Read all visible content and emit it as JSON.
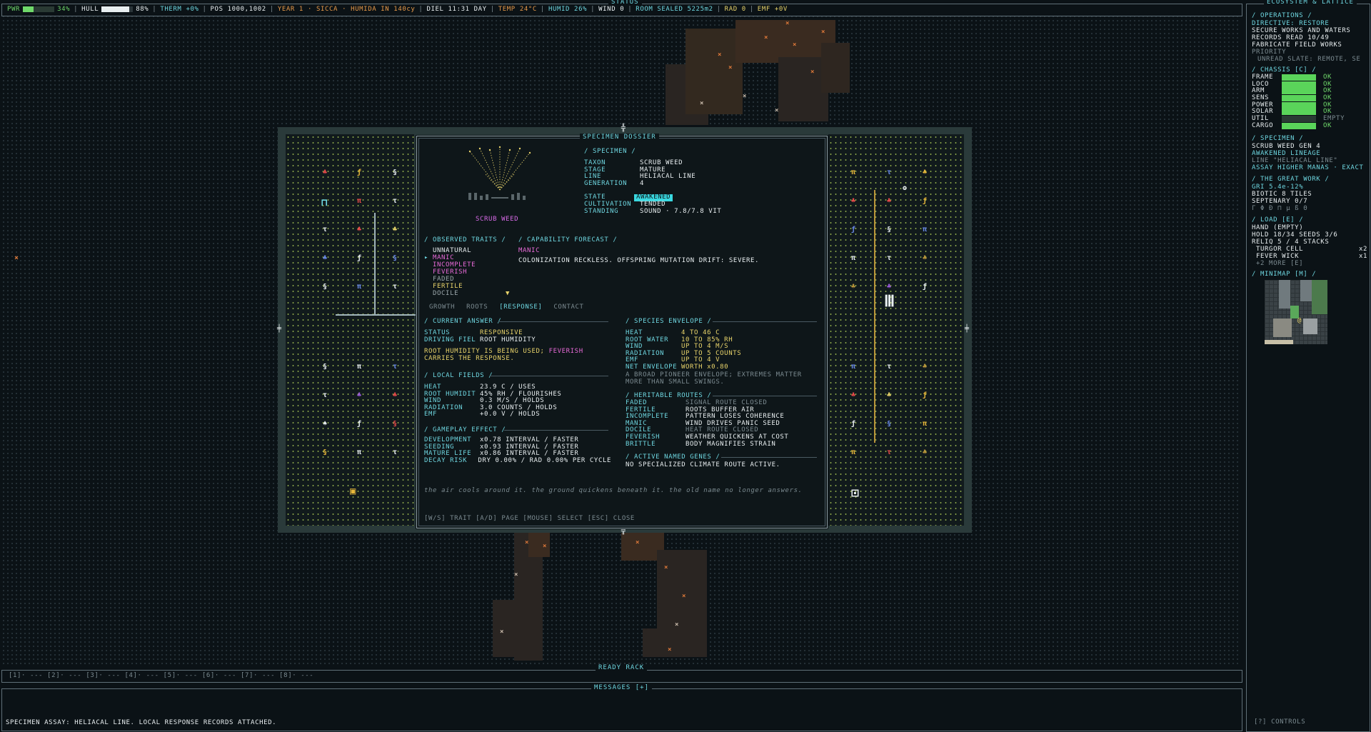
{
  "status_bar": {
    "title": "STATUS",
    "pwr_label": "PWR",
    "pwr_value": "34%",
    "hull_label": "HULL",
    "hull_value": "88%",
    "therm": "THERM +0%",
    "pos": "POS 1000,1002",
    "year": "YEAR 1 · SICCA · HUMIDA IN 140cy",
    "diel": "DIEL 11:31 DAY",
    "temp": "TEMP 24°C",
    "humid": "HUMID 26%",
    "wind": "WIND 0",
    "room": "ROOM SEALED 5225m2",
    "rad": "RAD 0",
    "emf": "EMF +0V",
    "pwr_fraction": 0.34,
    "hull_fraction": 0.88
  },
  "right_panel": {
    "title": "ECOSYSTEM & LATTICE",
    "operations": {
      "header": "/ OPERATIONS /",
      "lines": [
        "DIRECTIVE: RESTORE",
        "SECURE WORKS AND WATERS",
        "RECORDS READ 10/49",
        "FABRICATE FIELD WORKS"
      ],
      "priority_label": "PRIORITY",
      "priority_line": "UNREAD SLATE: REMOTE, SE"
    },
    "chassis": {
      "header": "/ CHASSIS [C] /",
      "rows": [
        {
          "name": "FRAME",
          "status": "OK"
        },
        {
          "name": "LOCO",
          "status": "OK"
        },
        {
          "name": "ARM",
          "status": "OK"
        },
        {
          "name": "SENS",
          "status": "OK"
        },
        {
          "name": "POWER",
          "status": "OK"
        },
        {
          "name": "SOLAR",
          "status": "OK"
        },
        {
          "name": "UTIL",
          "status": "EMPTY"
        },
        {
          "name": "CARGO",
          "status": "OK"
        }
      ]
    },
    "specimen": {
      "header": "/ SPECIMEN /",
      "line1": "SCRUB WEED  GEN 4",
      "line2": "AWAKENED LINEAGE",
      "line3": "LINE \"HELIACAL LINE\"",
      "line4": "ASSAY HIGHER MANAS · EXACT"
    },
    "great_work": {
      "header": "/ THE GREAT WORK /",
      "line1": "GRI 5.4e-12%",
      "line2": "BIOTIC 8 TILES",
      "line3": "SEPTENARY 0/7",
      "line4": "Γ Φ Ð ⊓ μ ß Θ"
    },
    "load": {
      "header": "/ LOAD [E] /",
      "line1": "HAND (EMPTY)",
      "line2": "HOLD 18/34  SEEDS 3/6",
      "line3": "RELIQ 5 / 4 STACKS",
      "items": [
        {
          "name": "TURGOR CELL",
          "count": "x2"
        },
        {
          "name": "FEVER WICK",
          "count": "x1"
        }
      ],
      "more": "+2 MORE [E]"
    },
    "minimap": {
      "header": "/ MINIMAP [M] /"
    },
    "controls": "[?] CONTROLS"
  },
  "dossier": {
    "title": "SPECIMEN DOSSIER",
    "plant_label": "SCRUB WEED",
    "specimen_header": "/ SPECIMEN /",
    "fields": [
      {
        "k": "TAXON",
        "v": "SCRUB WEED"
      },
      {
        "k": "STAGE",
        "v": "MATURE"
      },
      {
        "k": "LINE",
        "v": "HELIACAL LINE"
      },
      {
        "k": "GENERATION",
        "v": "4"
      }
    ],
    "state_label": "STATE",
    "state_value": "AWAKENED",
    "cultivation_label": "CULTIVATION",
    "cultivation_value": "TENDED",
    "standing_label": "STANDING",
    "standing_value": "SOUND · 7.8/7.8 VIT",
    "observed_header": "/ OBSERVED TRAITS /",
    "traits": [
      {
        "name": "UNNATURAL",
        "color": "#e8eef0"
      },
      {
        "name": "MANIC",
        "color": "#e86ad8"
      },
      {
        "name": "INCOMPLETE",
        "color": "#e86ad8"
      },
      {
        "name": "FEVERISH",
        "color": "#e86ad8"
      },
      {
        "name": "FADED",
        "color": "#9aa6aa"
      },
      {
        "name": "FERTILE",
        "color": "#e8d36a"
      },
      {
        "name": "DOCILE",
        "color": "#9aa6aa"
      }
    ],
    "forecast_header": "/ CAPABILITY FORECAST /",
    "forecast_trait": "MANIC",
    "forecast_text": "COLONIZATION RECKLESS. OFFSPRING MUTATION DRIFT: SEVERE.",
    "tabs": [
      "GROWTH",
      "ROOTS",
      "[RESPONSE]",
      "CONTACT"
    ],
    "current_answer": {
      "header": "/ CURRENT ANSWER /",
      "status_k": "STATUS",
      "status_v": "RESPONSIVE",
      "driving_k": "DRIVING FIEL",
      "driving_v": "ROOT HUMIDITY",
      "note1a": "ROOT HUMIDITY IS BEING USED;",
      "note1b": "FEVERISH",
      "note2": "CARRIES THE RESPONSE."
    },
    "local_fields": {
      "header": "/ LOCAL FIELDS /",
      "rows": [
        {
          "k": "HEAT",
          "v": "23.9 C / USES"
        },
        {
          "k": "ROOT HUMIDIT",
          "v": "45% RH / FLOURISHES"
        },
        {
          "k": "WIND",
          "v": "0.3 M/S / HOLDS"
        },
        {
          "k": "RADIATION",
          "v": "3.0 COUNTS / HOLDS"
        },
        {
          "k": "EMF",
          "v": "+0.0 V / HOLDS"
        }
      ]
    },
    "gameplay": {
      "header": "/ GAMEPLAY EFFECT /",
      "rows": [
        {
          "k": "DEVELOPMENT",
          "v": "x0.78 INTERVAL / FASTER"
        },
        {
          "k": "SEEDING",
          "v": "x0.93 INTERVAL / FASTER"
        },
        {
          "k": "MATURE LIFE",
          "v": "x0.86 INTERVAL / FASTER"
        }
      ],
      "decay_k": "DECAY RISK",
      "decay_v": "DRY 0.00% / RAD 0.00% PER CYCLE"
    },
    "envelope": {
      "header": "/ SPECIES ENVELOPE /",
      "rows": [
        {
          "k": "HEAT",
          "v": "4 TO 46 C"
        },
        {
          "k": "ROOT WATER",
          "v": "10 TO 85% RH"
        },
        {
          "k": "WIND",
          "v": "UP TO 4 M/S"
        },
        {
          "k": "RADIATION",
          "v": "UP TO 5 COUNTS"
        },
        {
          "k": "EMF",
          "v": "UP TO 4 V"
        },
        {
          "k": "NET ENVELOPE",
          "v": "WORTH x0.80"
        }
      ],
      "note1": "A BROAD PIONEER ENVELOPE; EXTREMES MATTER",
      "note2": "MORE THAN SMALL SWINGS."
    },
    "routes": {
      "header": "/ HERITABLE ROUTES /",
      "rows": [
        {
          "k": "FADED",
          "v": "SIGNAL ROUTE CLOSED",
          "dim": true
        },
        {
          "k": "FERTILE",
          "v": "ROOTS BUFFER AIR",
          "dim": false
        },
        {
          "k": "INCOMPLETE",
          "v": "PATTERN LOSES COHERENCE",
          "dim": false
        },
        {
          "k": "MANIC",
          "v": "WIND DRIVES PANIC SEED",
          "dim": false
        },
        {
          "k": "DOCILE",
          "v": "HEAT ROUTE CLOSED",
          "dim": true
        },
        {
          "k": "FEVERISH",
          "v": "WEATHER QUICKENS AT COST",
          "dim": false
        },
        {
          "k": "BRITTLE",
          "v": "BODY MAGNIFIES STRAIN",
          "dim": false
        }
      ]
    },
    "genes": {
      "header": "/ ACTIVE NAMED GENES /",
      "text": "NO SPECIALIZED CLIMATE ROUTE ACTIVE."
    },
    "flavor": "the air cools around it. the ground quickens beneath it. the old name no longer answers.",
    "controls": "[W/S] TRAIT   [A/D] PAGE   [MOUSE] SELECT   [ESC] CLOSE"
  },
  "ready_rack": {
    "title": "READY RACK",
    "slots": "[1]· ---   [2]· ---   [3]· ---   [4]· ---   [5]· ---   [6]· ---   [7]· ---   [8]· ---"
  },
  "messages": {
    "title": "MESSAGES [+]",
    "last": "SPECIMEN ASSAY: HELIACAL LINE. LOCAL RESPONSE RECORDS ATTACHED."
  }
}
